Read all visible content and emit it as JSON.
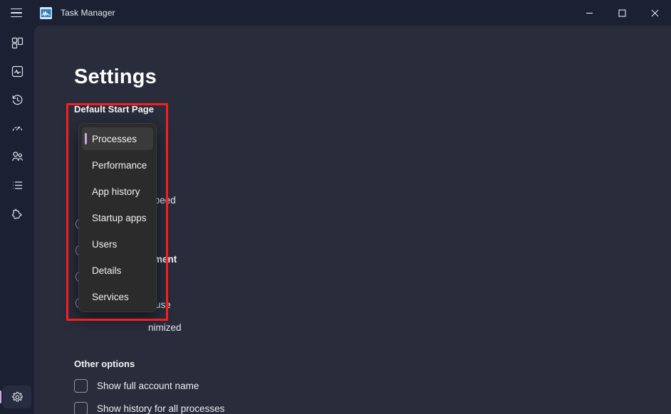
{
  "titlebar": {
    "menu_icon": "hamburger-icon",
    "app_icon": "task-manager-icon",
    "title": "Task Manager",
    "minimize_label": "—",
    "maximize_label": "☐",
    "close_label": "✕"
  },
  "rail": {
    "items": [
      {
        "icon": "processes-grid-icon",
        "name": "processes"
      },
      {
        "icon": "performance-pulse-icon",
        "name": "performance"
      },
      {
        "icon": "app-history-clock-icon",
        "name": "app-history"
      },
      {
        "icon": "startup-apps-speed-icon",
        "name": "startup-apps"
      },
      {
        "icon": "users-people-icon",
        "name": "users"
      },
      {
        "icon": "details-list-icon",
        "name": "details"
      },
      {
        "icon": "services-gear-icon",
        "name": "services"
      }
    ],
    "settings": {
      "icon": "settings-gear-icon",
      "name": "settings",
      "active": true
    }
  },
  "page": {
    "title": "Settings"
  },
  "sections": {
    "default_start_page": {
      "label": "Default Start Page",
      "selected": "Processes",
      "options": [
        "Processes",
        "Performance",
        "App history",
        "Startup apps",
        "Users",
        "Details",
        "Services"
      ]
    },
    "real_time_update_speed": {
      "partial_label": "speed"
    },
    "window_management": {
      "partial_label": "ment",
      "partial_option_1": "use",
      "partial_option_2": "nimized"
    },
    "other_options": {
      "label": "Other options",
      "checkboxes": [
        {
          "label": "Show full account name",
          "checked": false
        },
        {
          "label": "Show history for all processes",
          "checked": false
        }
      ]
    }
  },
  "colors": {
    "accent": "#c9a9e6",
    "annotation": "#f91e1e",
    "rail_bg": "#1b2033",
    "content_bg": "#282c3b",
    "flyout_bg": "#2b2b2b"
  }
}
